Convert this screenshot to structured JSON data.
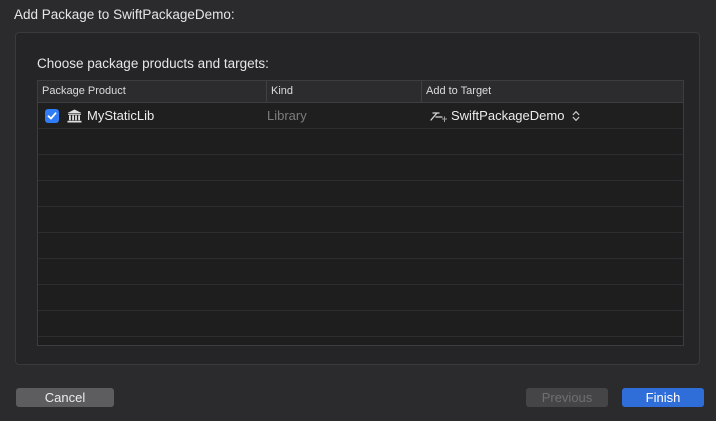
{
  "window": {
    "title": "Add Package to SwiftPackageDemo:"
  },
  "panel": {
    "heading": "Choose package products and targets:"
  },
  "table": {
    "columns": [
      "Package Product",
      "Kind",
      "Add to Target"
    ],
    "rows": [
      {
        "checked": true,
        "icon": "library-building-icon",
        "product": "MyStaticLib",
        "kind": "Library",
        "target_icon": "app-target-icon",
        "target": "SwiftPackageDemo"
      }
    ]
  },
  "buttons": {
    "cancel": "Cancel",
    "previous": "Previous",
    "finish": "Finish"
  },
  "colors": {
    "accent": "#2f7cf6",
    "finish_button": "#2f6ed8",
    "background": "#2b2b2d",
    "disabled_text": "#6f6f72"
  }
}
